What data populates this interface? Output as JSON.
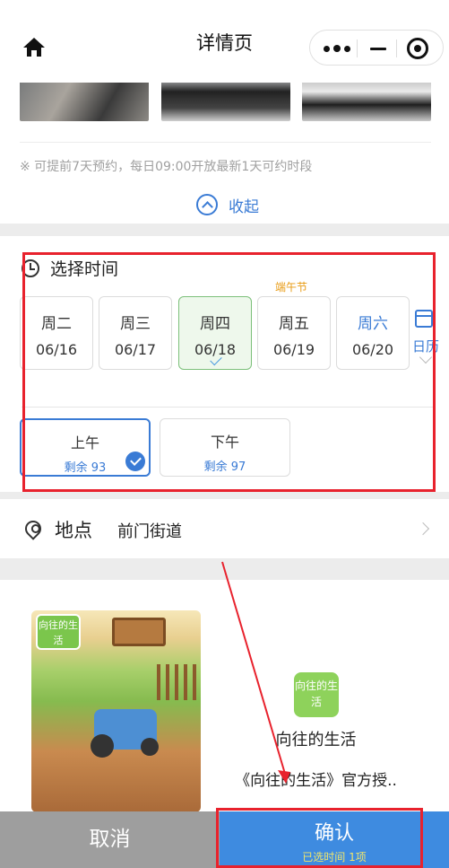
{
  "header": {
    "title": "详情页",
    "home_icon": "home-icon",
    "capsule_icons": [
      "more-icon",
      "minimize-icon",
      "close-icon"
    ]
  },
  "notice": "※ 可提前7天预约，每日09:00开放最新1天可约时段",
  "collapse_label": "收起",
  "time_section": {
    "title": "选择时间",
    "holiday_label": "端午节",
    "days": [
      {
        "weekday": "周二",
        "date": "06/16",
        "selected": false
      },
      {
        "weekday": "周三",
        "date": "06/17",
        "selected": false
      },
      {
        "weekday": "周四",
        "date": "06/18",
        "selected": true
      },
      {
        "weekday": "周五",
        "date": "06/19",
        "selected": false
      },
      {
        "weekday": "周六",
        "date": "06/20",
        "selected": false
      }
    ],
    "calendar_label": "日历",
    "slots": [
      {
        "label": "上午",
        "remaining": "剩余 93",
        "selected": true
      },
      {
        "label": "下午",
        "remaining": "剩余 97",
        "selected": false
      }
    ]
  },
  "location": {
    "title": "地点",
    "value": "前门街道"
  },
  "promo": {
    "game_logo_text": "向往的生活",
    "app_icon_text": "向往的生活",
    "app_name": "向往的生活",
    "description": "《向往的生活》官方授.."
  },
  "bottom": {
    "cancel_label": "取消",
    "confirm_label": "确认",
    "confirm_sub": "已选时间 1项"
  },
  "colors": {
    "accent": "#3a7bd5",
    "selected_day_bg": "#eef8ec",
    "holiday": "#e89a12",
    "annotation": "#e8222d",
    "cancel_bg": "#9e9e9e",
    "confirm_bg": "#3e8be0"
  }
}
